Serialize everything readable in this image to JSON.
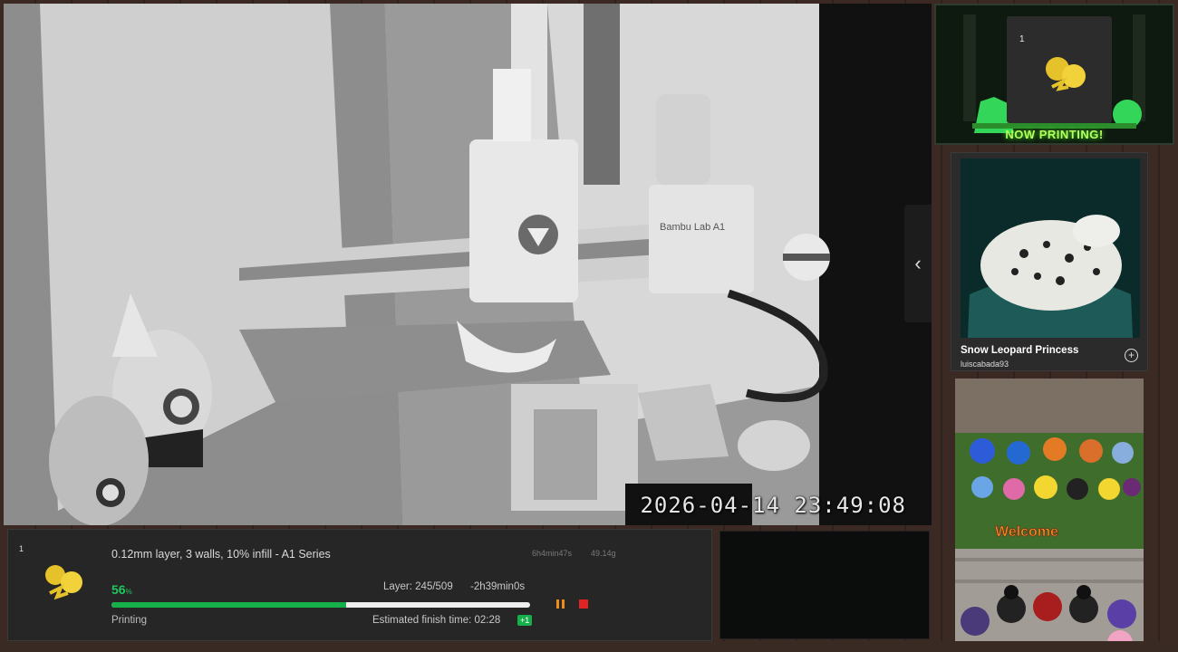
{
  "camera": {
    "timestamp": "2026-04-14 23:49:08",
    "printer_label": "Bambu Lab A1",
    "collapse_icon": "chevron-left-icon"
  },
  "now_printing": {
    "plate_number": "1",
    "banner": "NOW PRINTING!"
  },
  "model": {
    "name": "Snow Leopard Princess",
    "author": "luiscabada93",
    "add_icon": "plus-circle-icon"
  },
  "photos": {
    "welcome_sign": "Welcome"
  },
  "status": {
    "plate_number": "1",
    "job_title": "0.12mm layer, 3 walls, 10% infill - A1 Series",
    "total_time": "6h4min47s",
    "weight": "49.14g",
    "percent_value": "56",
    "percent_unit": "%",
    "progress": 0.56,
    "layer": "Layer: 245/509",
    "remaining": "-2h39min0s",
    "state": "Printing",
    "eta": "Estimated finish time: 02:28",
    "day_offset": "+1",
    "colors": {
      "accent": "#16b04a",
      "pause": "#f08c1a",
      "stop": "#e02424"
    }
  }
}
